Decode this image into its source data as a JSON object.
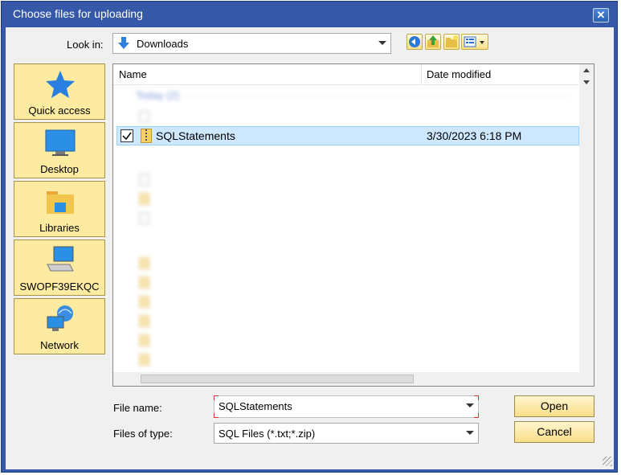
{
  "dialog": {
    "title": "Choose files for uploading",
    "close_glyph": "✕"
  },
  "lookin": {
    "label": "Look in:",
    "value": "Downloads"
  },
  "toolbar": {
    "back_icon": "back-arrow-icon",
    "up_icon": "up-folder-icon",
    "new_folder_icon": "new-folder-icon",
    "views_icon": "view-menu-icon"
  },
  "places": [
    {
      "label": "Quick access",
      "icon": "star-icon"
    },
    {
      "label": "Desktop",
      "icon": "desktop-icon"
    },
    {
      "label": "Libraries",
      "icon": "libraries-icon"
    },
    {
      "label": "SWOPF39EKQC",
      "icon": "computer-icon"
    },
    {
      "label": "Network",
      "icon": "network-icon"
    }
  ],
  "filelist": {
    "col_name": "Name",
    "col_date": "Date modified",
    "group_today": "Today (2)",
    "selected": {
      "name": "SQLStatements",
      "date": "3/30/2023 6:18 PM",
      "checked": true
    }
  },
  "file_name": {
    "label": "File name:",
    "value": "SQLStatements"
  },
  "file_type": {
    "label": "Files of type:",
    "value": "SQL Files (*.txt;*.zip)"
  },
  "buttons": {
    "open": "Open",
    "cancel": "Cancel"
  },
  "colors": {
    "titlebar": "#3658a8",
    "place_bg": "#fceba0",
    "selection": "#cde8ff"
  }
}
